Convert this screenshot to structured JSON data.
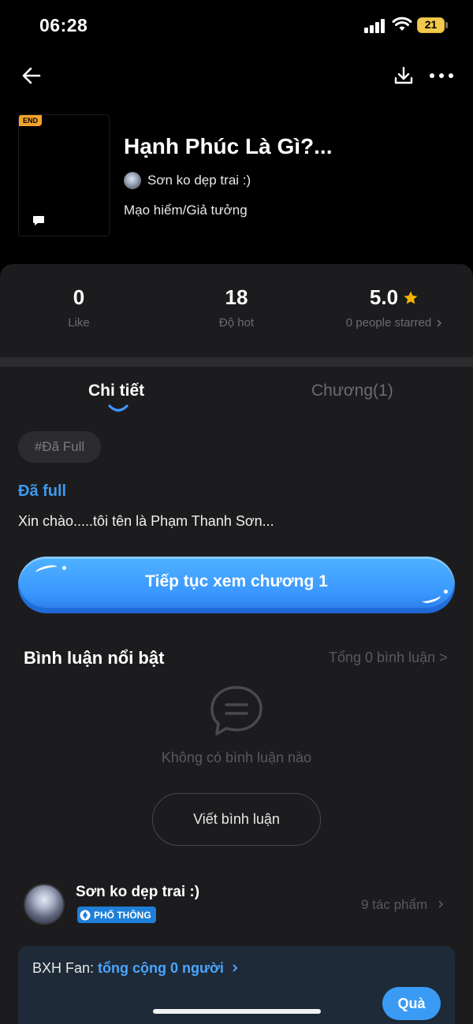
{
  "status_bar": {
    "time": "06:28",
    "battery": "21"
  },
  "header": {
    "badge": "END",
    "title": "Hạnh Phúc Là Gì?...",
    "author": "Sơn ko dẹp trai :)",
    "genre": "Mạo hiểm/Giả tưởng"
  },
  "stats": {
    "likes": {
      "value": "0",
      "label": "Like"
    },
    "hot": {
      "value": "18",
      "label": "Độ hot"
    },
    "rating": {
      "value": "5.0",
      "label": "0 people starred"
    }
  },
  "tabs": {
    "detail": "Chi tiết",
    "chapters": "Chương(1)"
  },
  "detail": {
    "tag": "#Đã Full",
    "status": "Đã full",
    "description": "Xin chào.....tôi tên là Phạm Thanh Sơn...",
    "continue_button": "Tiếp tục xem chương 1"
  },
  "comments": {
    "title": "Bình luận nổi bật",
    "total": "Tổng 0 bình luận >",
    "empty": "Không có bình luận nào",
    "write_button": "Viết bình luận"
  },
  "author_section": {
    "name": "Sơn ko dẹp trai :)",
    "level": "PHỔ THÔNG",
    "works": "9 tác phẩm"
  },
  "fan_ranking": {
    "prefix": "BXH Fan: ",
    "link": "tổng cộng 0 người",
    "gift_button": "Quà"
  },
  "colors": {
    "accent_blue": "#3a97ff",
    "card_background": "#1c1c1e",
    "star": "#f5b400",
    "end_badge": "#f3a32b"
  },
  "icons": [
    "back-arrow-icon",
    "download-icon",
    "more-icon",
    "chat-bubble-icon",
    "star-icon",
    "chevron-right-icon",
    "comment-icon",
    "diamond-icon"
  ]
}
